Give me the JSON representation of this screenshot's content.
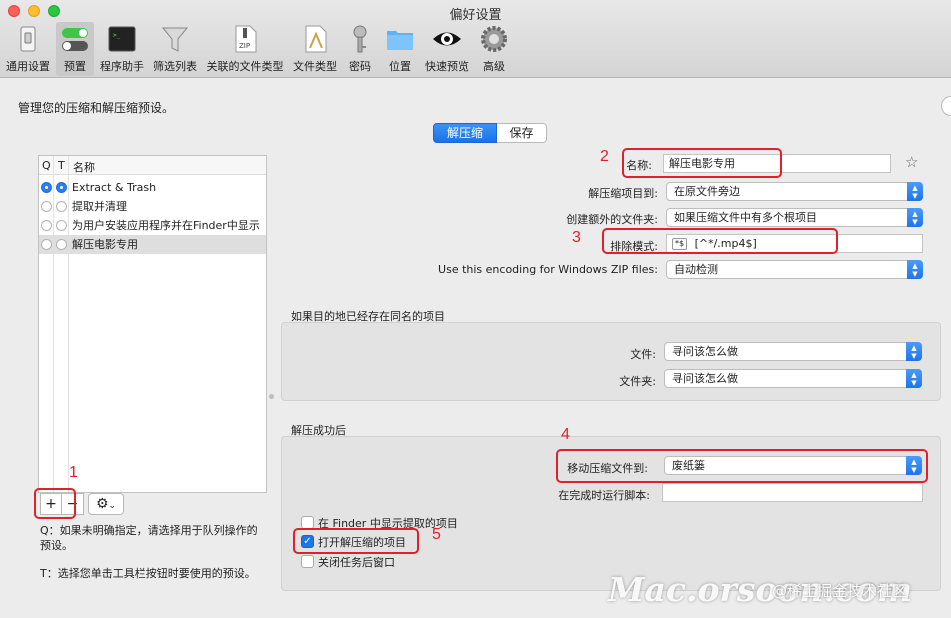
{
  "window": {
    "title": "偏好设置"
  },
  "toolbar": {
    "items": [
      {
        "label": "通用设置",
        "icon": "switch-icon"
      },
      {
        "label": "预置",
        "icon": "toggles-icon"
      },
      {
        "label": "程序助手",
        "icon": "terminal-icon"
      },
      {
        "label": "筛选列表",
        "icon": "funnel-icon"
      },
      {
        "label": "关联的文件类型",
        "icon": "zip-document-icon"
      },
      {
        "label": "文件类型",
        "icon": "app-document-icon"
      },
      {
        "label": "密码",
        "icon": "key-icon"
      },
      {
        "label": "位置",
        "icon": "folder-icon"
      },
      {
        "label": "快速预览",
        "icon": "eye-icon"
      },
      {
        "label": "高级",
        "icon": "gear-icon"
      }
    ]
  },
  "page": {
    "heading": "管理您的压缩和解压缩预设。"
  },
  "tabs": {
    "extract": "解压缩",
    "save": "保存"
  },
  "presets": {
    "headers": {
      "q": "Q",
      "t": "T",
      "name": "名称"
    },
    "rows": [
      {
        "name": "Extract & Trash"
      },
      {
        "name": "提取并清理"
      },
      {
        "name": "为用户安装应用程序并在Finder中显示"
      },
      {
        "name": "解压电影专用"
      }
    ],
    "add": "+",
    "remove": "−",
    "gear": "⚙",
    "gear_caret": "⌄"
  },
  "help": {
    "q_text": "Q：如果未明确指定，请选择用于队列操作的预设。",
    "t_text": "T：选择您单击工具栏按钮时要使用的预设。"
  },
  "form": {
    "name_label": "名称:",
    "name_value": "解压电影专用",
    "star": "☆",
    "extract_to_label": "解压缩项目到:",
    "extract_to_value": "在原文件旁边",
    "extra_folder_label": "创建额外的文件夹:",
    "extra_folder_value": "如果压缩文件中有多个根项目",
    "exclude_label": "排除模式:",
    "exclude_tag": "*$",
    "exclude_value": "[^*/.mp4$]",
    "encoding_label": "Use this encoding for Windows ZIP files:",
    "encoding_value": "自动检测"
  },
  "exists_group": {
    "title": "如果目的地已经存在同名的项目",
    "file_label": "文件:",
    "file_value": "寻问该怎么做",
    "folder_label": "文件夹:",
    "folder_value": "寻问该怎么做"
  },
  "success_group": {
    "title": "解压成功后",
    "move_label": "移动压缩文件到:",
    "move_value": "废纸篓",
    "script_label": "在完成时运行脚本:",
    "script_value": "",
    "show_finder": "在 Finder 中显示提取的项目",
    "open_items": "打开解压缩的项目",
    "close_window": "关闭任务后窗口"
  },
  "annotations": [
    "1",
    "2",
    "3",
    "4",
    "5"
  ],
  "watermark": {
    "text": "Mac.orsoon.com",
    "credit": "@稀土掘金技术社区"
  },
  "colors": {
    "accent": "#1f74ea",
    "annotation": "#e0202a"
  }
}
